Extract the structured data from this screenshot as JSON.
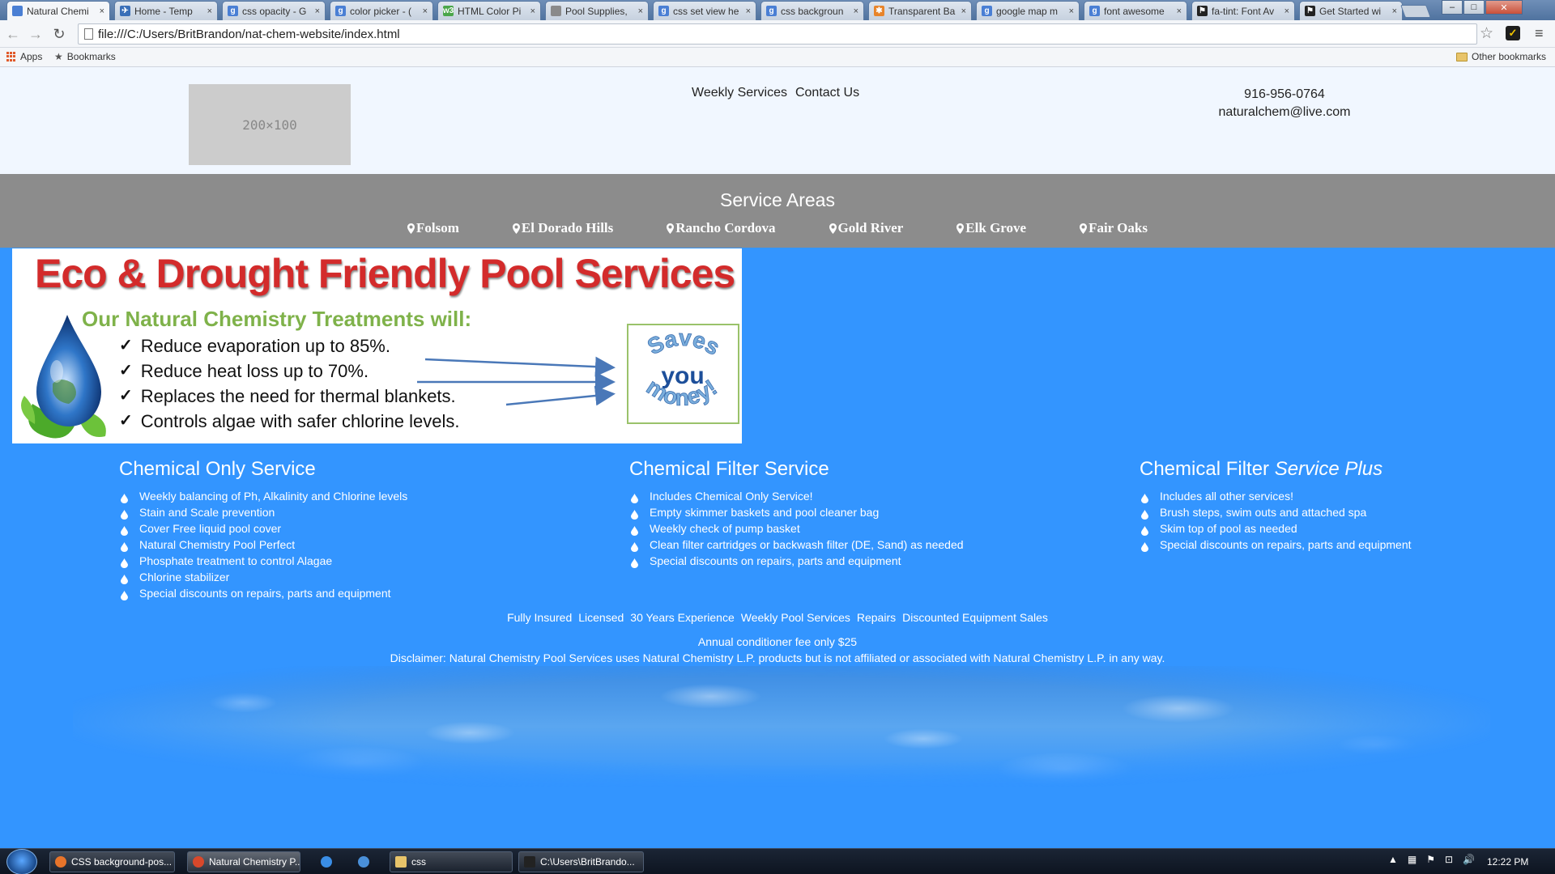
{
  "browser": {
    "tabs": [
      {
        "label": "Natural Chemi",
        "favicon": "page-icon",
        "color": "#4a7fd4"
      },
      {
        "label": "Home - Temp",
        "favicon": "bird-icon",
        "color": "#3a6fb8"
      },
      {
        "label": "css opacity - G",
        "favicon": "google-icon",
        "color": "#4a7fd4"
      },
      {
        "label": "color picker - (",
        "favicon": "google-icon",
        "color": "#4a7fd4"
      },
      {
        "label": "HTML Color Pi",
        "favicon": "w3-icon",
        "color": "#4aa64a"
      },
      {
        "label": "Pool Supplies,",
        "favicon": "page-icon",
        "color": "#8a8a8a"
      },
      {
        "label": "css set view he",
        "favicon": "google-icon",
        "color": "#4a7fd4"
      },
      {
        "label": "css backgroun",
        "favicon": "google-icon",
        "color": "#4a7fd4"
      },
      {
        "label": "Transparent Ba",
        "favicon": "star-icon",
        "color": "#e8842a"
      },
      {
        "label": "google map m",
        "favicon": "google-icon",
        "color": "#4a7fd4"
      },
      {
        "label": "font awesome",
        "favicon": "google-icon",
        "color": "#4a7fd4"
      },
      {
        "label": "fa-tint: Font Av",
        "favicon": "flag-icon",
        "color": "#222222"
      },
      {
        "label": "Get Started wi",
        "favicon": "flag-icon",
        "color": "#222222"
      }
    ],
    "favicon_letters": {
      "google-icon": "g",
      "w3-icon": "w3",
      "star-icon": "✱",
      "flag-icon": "⚑",
      "page-icon": "",
      "bird-icon": "✈"
    },
    "tab_close": "×",
    "window_controls": {
      "minimize": "–",
      "maximize": "□",
      "close": "✕"
    },
    "address": "file:///C:/Users/BritBrandon/nat-chem-website/index.html",
    "bookmarks": {
      "apps": "Apps",
      "bookmarks": "Bookmarks",
      "other": "Other bookmarks"
    }
  },
  "site": {
    "logo_placeholder": "200×100",
    "nav": [
      "Weekly Services",
      "Contact Us"
    ],
    "phone": "916-956-0764",
    "email": "naturalchem@live.com",
    "areas_title": "Service Areas",
    "areas": [
      "Folsom",
      "El Dorado Hills",
      "Rancho Cordova",
      "Gold River",
      "Elk Grove",
      "Fair Oaks"
    ],
    "banner": {
      "title": "Eco & Drought Friendly Pool Services",
      "subtitle": "Our Natural Chemistry Treatments will:",
      "items": [
        "Reduce evaporation up to 85%.",
        "Reduce heat loss up to 70%.",
        "Replaces the need for thermal blankets.",
        "Controls algae with safer chlorine levels."
      ],
      "check": "✓",
      "badge_top": "Saves",
      "badge_mid": "you",
      "badge_bottom": "money!"
    },
    "services": [
      {
        "title": "Chemical Only Service",
        "title_em": "",
        "items": [
          "Weekly balancing of Ph, Alkalinity and Chlorine levels",
          "Stain and Scale prevention",
          "Cover Free liquid pool cover",
          "Natural Chemistry Pool Perfect",
          "Phosphate treatment to control Alagae",
          "Chlorine stabilizer",
          "Special discounts on repairs, parts and equipment"
        ]
      },
      {
        "title": "Chemical Filter Service",
        "title_em": "",
        "items": [
          "Includes Chemical Only Service!",
          "Empty skimmer baskets and pool cleaner bag",
          "Weekly check of pump basket",
          "Clean filter cartridges or backwash filter (DE, Sand) as needed",
          "Special discounts on repairs, parts and equipment"
        ]
      },
      {
        "title": "Chemical Filter ",
        "title_em": "Service Plus",
        "items": [
          "Includes all other services!",
          "Brush steps, swim outs and attached spa",
          "Skim top of pool as needed",
          "Special discounts on repairs, parts and equipment"
        ]
      }
    ],
    "badges": [
      "Fully Insured",
      "Licensed",
      "30 Years Experience",
      "Weekly Pool Services",
      "Repairs",
      "Discounted Equipment Sales"
    ],
    "fee": "Annual conditioner fee only $25",
    "disclaimer": "Disclaimer: Natural Chemistry Pool Services uses Natural Chemistry L.P. products but is not affiliated or associated with Natural Chemistry L.P. in any way."
  },
  "taskbar": {
    "items": [
      {
        "label": "CSS background-pos...",
        "icon": "firefox-icon",
        "color": "#e8742a"
      },
      {
        "label": "Natural Chemistry P...",
        "icon": "chrome-icon",
        "color": "#d9482b"
      },
      {
        "label": "",
        "icon": "ie-icon",
        "color": "#3a8ee6"
      },
      {
        "label": "",
        "icon": "chrome-icon",
        "color": "#4a90d9"
      },
      {
        "label": "css",
        "icon": "folder-icon",
        "color": "#e8c46a"
      },
      {
        "label": "C:\\Users\\BritBrando...",
        "icon": "cmd-icon",
        "color": "#222222"
      }
    ],
    "tray_icons": [
      "▲",
      "▦",
      "⚑",
      "⊡",
      "🔊"
    ],
    "clock": "12:22 PM"
  },
  "colors": {
    "page_bg": "#3395ff",
    "header_bg": "#f1f7ff",
    "areas_bg": "#8c8c8c",
    "title_red": "#d32b2b",
    "subtitle_green": "#7fb24a"
  }
}
